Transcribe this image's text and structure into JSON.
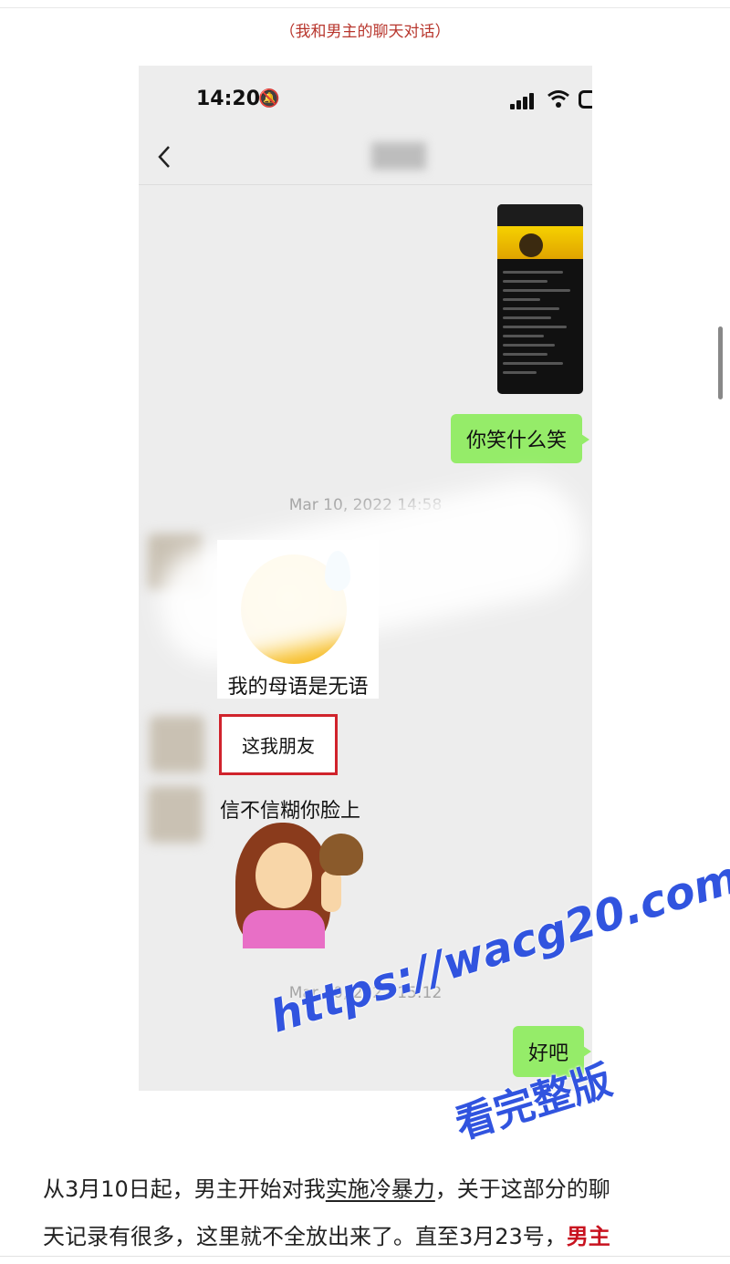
{
  "article": {
    "caption": "（我和男主的聊天对话）",
    "paragraph": {
      "line1_a": "从3月10日起，男主开始对我",
      "line1_underlined": "实施冷暴力",
      "line1_b": "，关于这部分的聊",
      "line2_a": "天记录有很多，这里就不全放出来了。直至3月23号，",
      "line2_red": "男主"
    }
  },
  "phone": {
    "status_bar": {
      "time": "14:20",
      "icons": [
        "bell-muted-icon",
        "signal-icon",
        "wifi-icon",
        "battery-icon"
      ]
    },
    "nav": {
      "icons": [
        "back-chevron-icon"
      ],
      "contact_name_blurred": true
    },
    "messages": [
      {
        "side": "me",
        "type": "image",
        "description_icon": "screenshot-thumbnail"
      },
      {
        "side": "me",
        "type": "text",
        "text": "你笑什么笑"
      },
      {
        "type": "timestamp",
        "text": "Mar 10, 2022 14:58"
      },
      {
        "side": "other",
        "type": "sticker",
        "text": "我的母语是无语"
      },
      {
        "side": "other",
        "type": "text",
        "text": "这我朋友",
        "highlighted": true
      },
      {
        "side": "other",
        "type": "sticker",
        "text": "信不信糊你脸上"
      },
      {
        "type": "timestamp",
        "text": "Mar 10, 2022 15:12"
      },
      {
        "side": "me",
        "type": "text",
        "text": "好吧"
      }
    ]
  },
  "watermark": {
    "line1": "https://wacg20.com",
    "line2": "看完整版"
  },
  "colors": {
    "caption": "#b8362d",
    "my_bubble": "#95ec69",
    "highlight_box": "#d0232c",
    "emphasis_red": "#c8121f",
    "watermark": "#3154df"
  }
}
